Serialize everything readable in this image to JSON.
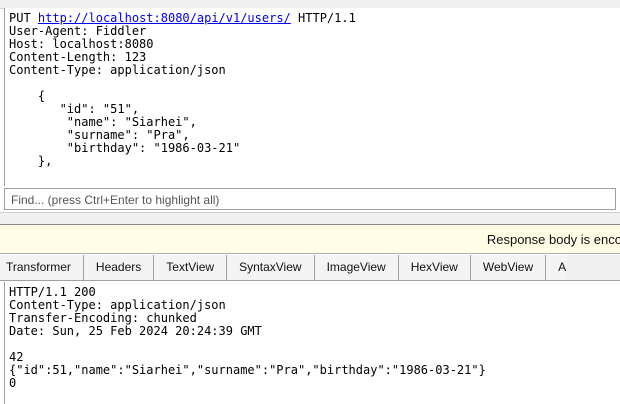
{
  "request": {
    "method": "PUT",
    "url": "http://localhost:8080/api/v1/users/",
    "protocol": "HTTP/1.1",
    "headers_and_body": "User-Agent: Fiddler\nHost: localhost:8080\nContent-Length: 123\nContent-Type: application/json\n\n    {\n       \"id\": \"51\",\n        \"name\": \"Siarhei\",\n        \"surname\": \"Pra\",\n        \"birthday\": \"1986-03-21\"\n    },"
  },
  "find": {
    "placeholder": "Find... (press Ctrl+Enter to highlight all)"
  },
  "notice": {
    "text": "Response body is enco"
  },
  "response_tabs": [
    {
      "label": "Transformer"
    },
    {
      "label": "Headers"
    },
    {
      "label": "TextView"
    },
    {
      "label": "SyntaxView"
    },
    {
      "label": "ImageView"
    },
    {
      "label": "HexView"
    },
    {
      "label": "WebView"
    },
    {
      "label": "A"
    }
  ],
  "response": {
    "raw": "HTTP/1.1 200\nContent-Type: application/json\nTransfer-Encoding: chunked\nDate: Sun, 25 Feb 2024 20:24:39 GMT\n\n42\n{\"id\":51,\"name\":\"Siarhei\",\"surname\":\"Pra\",\"birthday\":\"1986-03-21\"}\n0"
  }
}
